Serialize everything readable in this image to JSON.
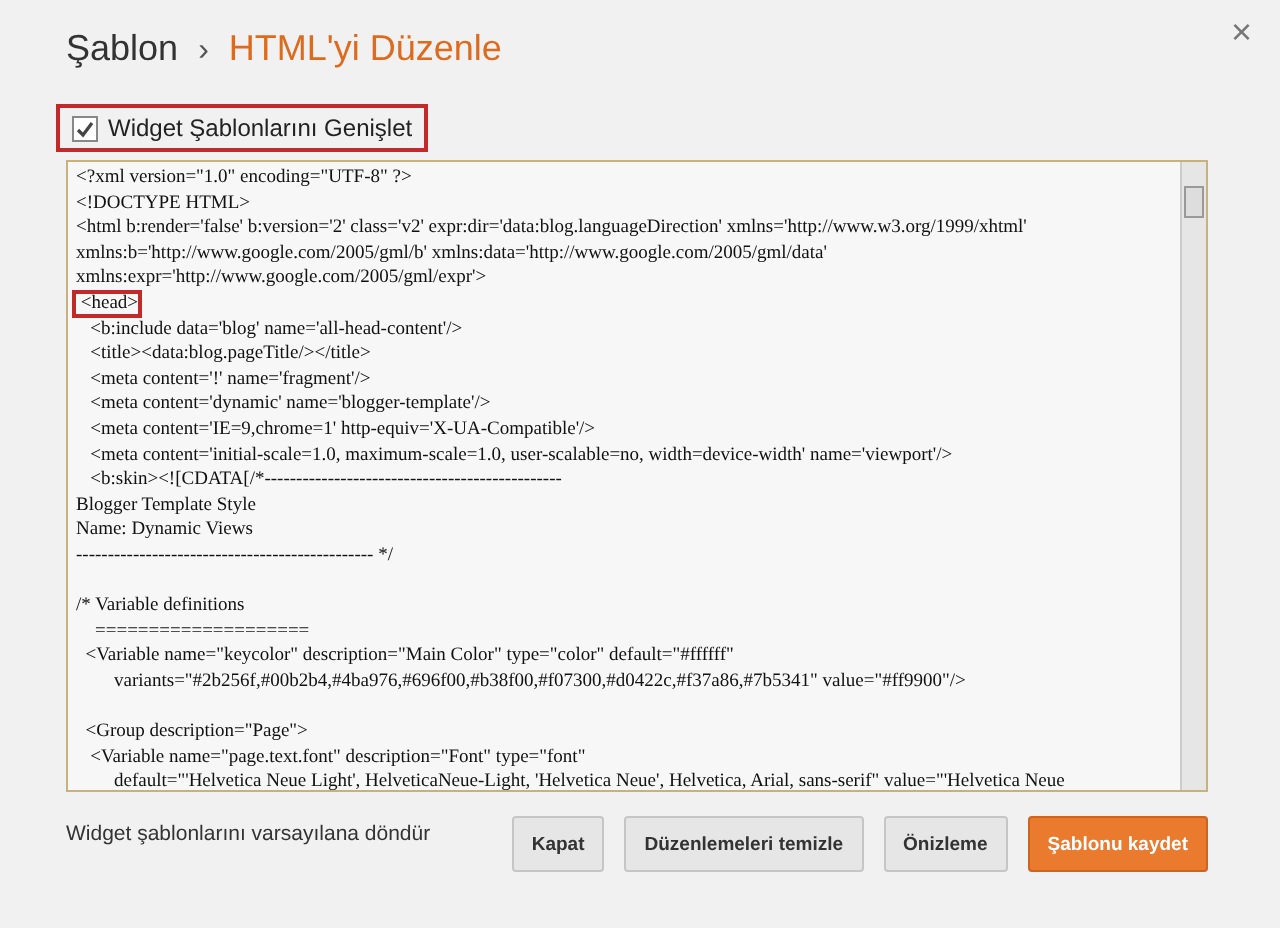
{
  "breadcrumb": {
    "parent": "Şablon",
    "separator": "›",
    "current": "HTML'yi Düzenle"
  },
  "close": "×",
  "expand_widgets": {
    "label": "Widget Şablonlarını Genişlet",
    "checked": true
  },
  "editor": {
    "lines": [
      {
        "kind": "code",
        "text": "<?xml version=\"1.0\" encoding=\"UTF-8\" ?>",
        "highlighted": false
      },
      {
        "kind": "code",
        "text": "<!DOCTYPE HTML>",
        "highlighted": false
      },
      {
        "kind": "code",
        "text": "<html b:render='false' b:version='2' class='v2' expr:dir='data:blog.languageDirection' xmlns='http://www.w3.org/1999/xhtml'",
        "highlighted": false
      },
      {
        "kind": "code",
        "text": "xmlns:b='http://www.google.com/2005/gml/b' xmlns:data='http://www.google.com/2005/gml/data'",
        "highlighted": false
      },
      {
        "kind": "code",
        "text": "xmlns:expr='http://www.google.com/2005/gml/expr'>",
        "highlighted": false
      },
      {
        "kind": "code",
        "text": " <head>",
        "highlighted": true
      },
      {
        "kind": "code",
        "text": "   <b:include data='blog' name='all-head-content'/>",
        "highlighted": false
      },
      {
        "kind": "code",
        "text": "   <title><data:blog.pageTitle/></title>",
        "highlighted": false
      },
      {
        "kind": "code",
        "text": "   <meta content='!' name='fragment'/>",
        "highlighted": false
      },
      {
        "kind": "code",
        "text": "   <meta content='dynamic' name='blogger-template'/>",
        "highlighted": false
      },
      {
        "kind": "code",
        "text": "   <meta content='IE=9,chrome=1' http-equiv='X-UA-Compatible'/>",
        "highlighted": false
      },
      {
        "kind": "code",
        "text": "   <meta content='initial-scale=1.0, maximum-scale=1.0, user-scalable=no, width=device-width' name='viewport'/>",
        "highlighted": false
      },
      {
        "kind": "code",
        "text": "   <b:skin><![CDATA[/*-----------------------------------------------",
        "highlighted": false
      },
      {
        "kind": "code",
        "text": "Blogger Template Style",
        "highlighted": false
      },
      {
        "kind": "code",
        "text": "Name: Dynamic Views",
        "highlighted": false
      },
      {
        "kind": "code",
        "text": "----------------------------------------------- */",
        "highlighted": false
      },
      {
        "kind": "blank"
      },
      {
        "kind": "code",
        "text": "/* Variable definitions",
        "highlighted": false
      },
      {
        "kind": "code",
        "text": "    ====================",
        "highlighted": false
      },
      {
        "kind": "code",
        "text": "  <Variable name=\"keycolor\" description=\"Main Color\" type=\"color\" default=\"#ffffff\"",
        "highlighted": false
      },
      {
        "kind": "code",
        "text": "        variants=\"#2b256f,#00b2b4,#4ba976,#696f00,#b38f00,#f07300,#d0422c,#f37a86,#7b5341\" value=\"#ff9900\"/>",
        "highlighted": false
      },
      {
        "kind": "blank"
      },
      {
        "kind": "code",
        "text": "  <Group description=\"Page\">",
        "highlighted": false
      },
      {
        "kind": "code",
        "text": "   <Variable name=\"page.text.font\" description=\"Font\" type=\"font\"",
        "highlighted": false
      },
      {
        "kind": "code",
        "text": "        default=\"'Helvetica Neue Light', HelveticaNeue-Light, 'Helvetica Neue', Helvetica, Arial, sans-serif\" value=\"'Helvetica Neue",
        "highlighted": false
      }
    ]
  },
  "revert_link": "Widget şablonlarını varsayılana döndür",
  "buttons": [
    {
      "label": "Kapat",
      "kind": "plain"
    },
    {
      "label": "Düzenlemeleri temizle",
      "kind": "plain"
    },
    {
      "label": "Önizleme",
      "kind": "plain"
    },
    {
      "label": "Şablonu kaydet",
      "kind": "primary"
    }
  ]
}
